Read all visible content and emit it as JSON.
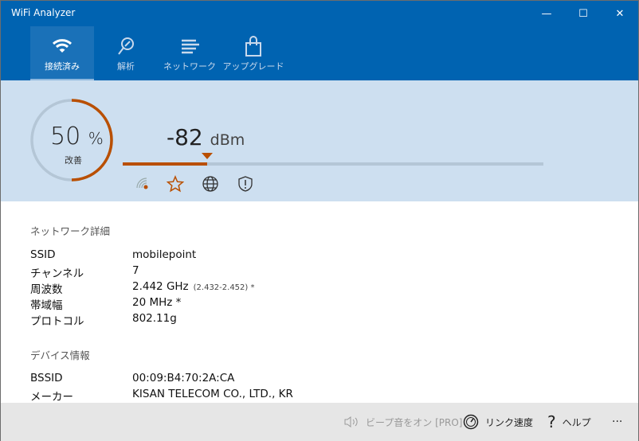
{
  "window": {
    "title": "WiFi Analyzer"
  },
  "colors": {
    "accent": "#b94f00",
    "titlebar": "#0063b1",
    "panel": "#cddff0"
  },
  "tabs": [
    {
      "label": "接続済み",
      "icon": "wifi-icon",
      "active": true
    },
    {
      "label": "解析",
      "icon": "analyze-icon"
    },
    {
      "label": "ネットワーク",
      "icon": "network-list-icon"
    },
    {
      "label": "アップグレード",
      "icon": "shopping-bag-icon"
    }
  ],
  "signal": {
    "quality_percent": "50",
    "percent_sign": "%",
    "quality_label": "改善",
    "dbm_value": "-82",
    "dbm_unit": "dBm",
    "bar_fraction": 0.2
  },
  "status_icons": [
    "signal-icon",
    "star-icon",
    "globe-icon",
    "shield-icon"
  ],
  "network_details": {
    "heading": "ネットワーク詳細",
    "rows": [
      {
        "key": "SSID",
        "value": "mobilepoint"
      },
      {
        "key": "チャンネル",
        "value": "7"
      },
      {
        "key": "周波数",
        "value": "2.442 GHz",
        "sub": "(2.432-2.452) *"
      },
      {
        "key": "帯域幅",
        "value": "20 MHz *"
      },
      {
        "key": "プロトコル",
        "value": "802.11g"
      }
    ]
  },
  "device_info": {
    "heading": "デバイス情報",
    "rows": [
      {
        "key": "BSSID",
        "value": "00:09:B4:70:2A:CA"
      },
      {
        "key": "メーカー",
        "value": "KISAN TELECOM CO., LTD., KR"
      }
    ]
  },
  "footer": {
    "beep": "ビープ音をオン [PRO]",
    "link_speed": "リンク速度",
    "help": "ヘルプ",
    "more": "···"
  }
}
